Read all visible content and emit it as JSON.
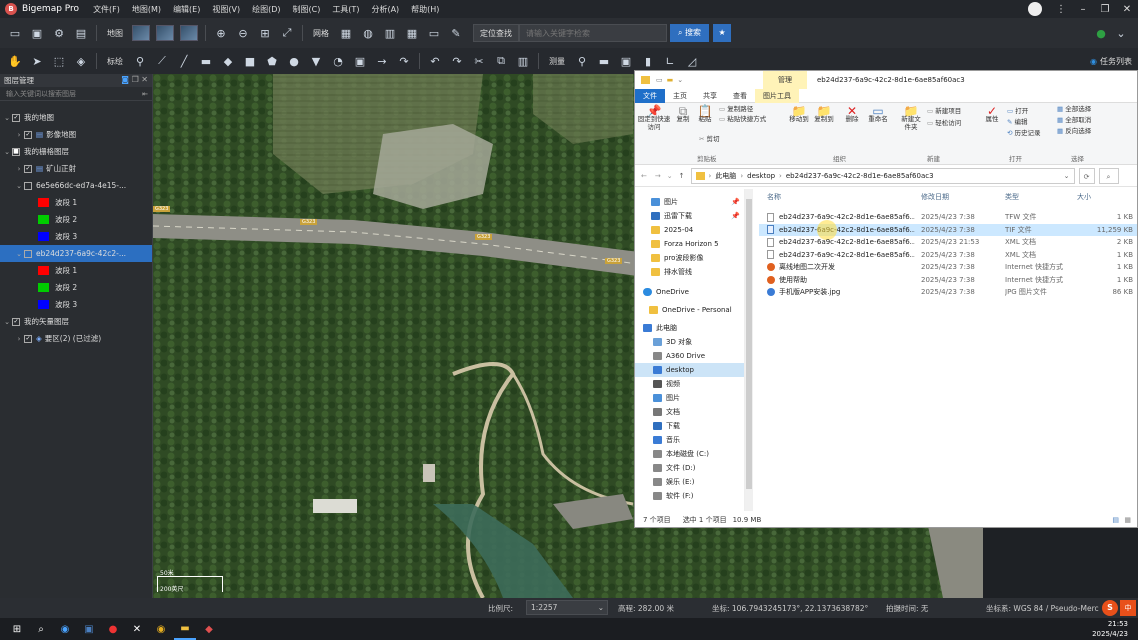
{
  "app": {
    "name": "Bigemap Pro",
    "menu": [
      "文件(F)",
      "地图(M)",
      "编辑(E)",
      "视图(V)",
      "绘图(D)",
      "制图(C)",
      "工具(T)",
      "分析(A)",
      "帮助(H)"
    ]
  },
  "toolbar1": {
    "map_label": "地图",
    "network_label": "网格",
    "search_select": "定位查找",
    "search_placeholder": "请输入关键字检索",
    "search_button": "搜索"
  },
  "toolbar2": {
    "label_label": "标绘",
    "measure_label": "测量"
  },
  "right_panel": {
    "task_list": "任务列表"
  },
  "sidebar": {
    "title": "图层管理",
    "filter_placeholder": "输入关键词以搜索图层",
    "items": [
      {
        "label": "我的地图"
      },
      {
        "label": "影像地图"
      },
      {
        "label": "我的栅格图层"
      },
      {
        "label": "矿山正射"
      },
      {
        "label": "6e5e66dc-ed7a-4e15-..."
      },
      {
        "label": "波段 1",
        "color": "#ff0000"
      },
      {
        "label": "波段 2",
        "color": "#00cc00"
      },
      {
        "label": "波段 3",
        "color": "#0000ff"
      },
      {
        "label": "eb24d237-6a9c-42c2-..."
      },
      {
        "label": "波段 1",
        "color": "#ff0000"
      },
      {
        "label": "波段 2",
        "color": "#00cc00"
      },
      {
        "label": "波段 3",
        "color": "#0000ff"
      },
      {
        "label": "我的矢量图层"
      },
      {
        "label": "要区(2) (已过滤)"
      }
    ]
  },
  "map": {
    "road_label_1": "G323",
    "road_label_2": "G323",
    "road_label_3": "G323",
    "road_label_4": "G323",
    "scale_top": "50米",
    "scale_bottom": "200英尺"
  },
  "explorer": {
    "title": "eb24d237-6a9c-42c2-8d1e-6ae85af60ac3",
    "manage_tab": "管理",
    "tabs": [
      "文件",
      "主页",
      "共享",
      "查看",
      "图片工具"
    ],
    "ribbon": {
      "pin": "固定到快速访问",
      "copy": "复制",
      "paste": "粘贴",
      "copy_path": "复制路径",
      "paste_shortcut": "粘贴快捷方式",
      "cut": "剪切",
      "group_clipboard": "剪贴板",
      "move_to": "移动到",
      "copy_to": "复制到",
      "delete": "删除",
      "rename": "重命名",
      "group_organize": "组织",
      "new_folder": "新建文件夹",
      "new_item": "新建项目",
      "easy_access": "轻松访问",
      "group_new": "新建",
      "properties": "属性",
      "open": "打开",
      "edit": "编辑",
      "history": "历史记录",
      "group_open": "打开",
      "select_all": "全部选择",
      "select_none": "全部取消",
      "invert": "反向选择",
      "group_select": "选择"
    },
    "address": [
      "此电脑",
      "desktop",
      "eb24d237-6a9c-42c2-8d1e-6ae85af60ac3"
    ],
    "nav": [
      {
        "label": "图片",
        "color": "#4a90d9"
      },
      {
        "label": "迅雷下载",
        "color": "#2f6fbf"
      },
      {
        "label": "2025-04",
        "color": "#f0c040"
      },
      {
        "label": "Forza Horizon 5",
        "color": "#f0c040"
      },
      {
        "label": "pro波段影像",
        "color": "#f0c040"
      },
      {
        "label": "排水管线",
        "color": "#f0c040"
      },
      {
        "label": "OneDrive",
        "color": "#2b8be0"
      },
      {
        "label": "OneDrive - Personal",
        "color": "#f0c040"
      },
      {
        "label": "此电脑",
        "color": "#3a7bd5"
      },
      {
        "label": "3D 对象",
        "color": "#6aa0d8"
      },
      {
        "label": "A360 Drive",
        "color": "#888888"
      },
      {
        "label": "desktop",
        "color": "#3a7bd5"
      },
      {
        "label": "视频",
        "color": "#555555"
      },
      {
        "label": "图片",
        "color": "#4a90d9"
      },
      {
        "label": "文档",
        "color": "#777777"
      },
      {
        "label": "下载",
        "color": "#2f6fbf"
      },
      {
        "label": "音乐",
        "color": "#3a7bd5"
      },
      {
        "label": "本地磁盘 (C:)",
        "color": "#888888"
      },
      {
        "label": "文件 (D:)",
        "color": "#888888"
      },
      {
        "label": "娱乐 (E:)",
        "color": "#888888"
      },
      {
        "label": "软件 (F:)",
        "color": "#888888"
      }
    ],
    "columns": {
      "name": "名称",
      "date": "修改日期",
      "type": "类型",
      "size": "大小"
    },
    "files": [
      {
        "name": "eb24d237-6a9c-42c2-8d1e-6ae85af6...",
        "date": "2025/4/23 7:38",
        "type": "TFW 文件",
        "size": "1 KB"
      },
      {
        "name": "eb24d237-6a9c-42c2-8d1e-6ae85af6...",
        "date": "2025/4/23 7:38",
        "type": "TIF 文件",
        "size": "11,259 KB"
      },
      {
        "name": "eb24d237-6a9c-42c2-8d1e-6ae85af6...",
        "date": "2025/4/23 21:53",
        "type": "XML 文档",
        "size": "2 KB"
      },
      {
        "name": "eb24d237-6a9c-42c2-8d1e-6ae85af6...",
        "date": "2025/4/23 7:38",
        "type": "XML 文档",
        "size": "1 KB"
      },
      {
        "name": "离线地图二次开发",
        "date": "2025/4/23 7:38",
        "type": "Internet 快捷方式",
        "size": "1 KB"
      },
      {
        "name": "使用帮助",
        "date": "2025/4/23 7:38",
        "type": "Internet 快捷方式",
        "size": "1 KB"
      },
      {
        "name": "手机版APP安装.jpg",
        "date": "2025/4/23 7:38",
        "type": "JPG 图片文件",
        "size": "86 KB"
      }
    ],
    "status": {
      "count": "7 个项目",
      "selected": "选中 1 个项目",
      "size": "10.9 MB"
    }
  },
  "statusbar": {
    "scale_label": "比例尺:",
    "scale_value": "1:2257",
    "elevation": "高程: 282.00 米",
    "coords": "坐标: 106.7943245173°, 22.1373638782°",
    "time": "拍摄时间: 无",
    "crs": "坐标系: WGS 84 / Pseudo-Merc"
  },
  "taskbar": {
    "time": "21:53",
    "date": "2025/4/23"
  }
}
